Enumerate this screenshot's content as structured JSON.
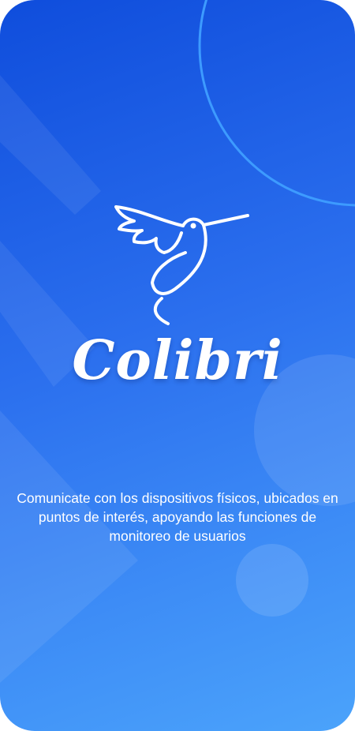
{
  "app": {
    "name": "Colibri",
    "logo_icon": "hummingbird-icon",
    "tagline": "Comunicate con los dispositivos físicos, ubicados en puntos de interés, apoyando las funciones de monitoreo de usuarios"
  },
  "colors": {
    "gradient_start": "#0f4ddc",
    "gradient_end": "#4ba3fb",
    "text": "#ffffff",
    "ring": "#3d9bff"
  }
}
